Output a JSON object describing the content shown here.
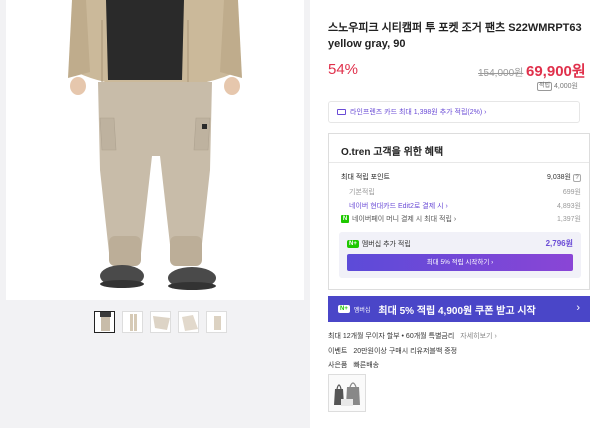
{
  "product": {
    "title": "스노우피크 시티캠퍼 투 포켓 조거 팬츠 S22WMRPT63 yellow gray, 90",
    "discount": "54%",
    "original_price": "154,000원",
    "price": "69,900원",
    "point_badge": "적립",
    "point": "4,000원"
  },
  "card_banner": {
    "text": "라인프렌즈 카드 최대 1,398원 추가 적립(2%) ›"
  },
  "benefit": {
    "title": "O.tren 고객을 위한 혜택",
    "max_point_label": "최대 적립 포인트",
    "max_point_value": "9,038원",
    "help": "?",
    "base_label": "기본적립",
    "base_value": "699원",
    "card_label": "네이버 현대카드 Edit2로 결제 시 ›",
    "card_value": "4,893원",
    "npay_label": "네이버페이 머니 결제 시 최대 적립 ›",
    "npay_value": "1,397원",
    "npay_icon": "N",
    "member_badge": "N+",
    "member_label": "멤버십 추가 적립",
    "member_value": "2,796원",
    "member_button": "최대 5% 적립 시작하기 ›"
  },
  "coupon": {
    "badge": "N+",
    "badge_label": "멤버십",
    "text": "최대 5% 적립 4,900원 쿠폰 받고 시작",
    "arrow": "›"
  },
  "info": {
    "installment_text": "최대 12개월 무이자 할부 • 60개월 특별금리",
    "installment_more": "자세히보기 ›",
    "event_label": "이벤트",
    "event_text": "20만원이상 구매시 리유저블백 증정",
    "gift_label": "사은품",
    "gift_text": "빠른배송"
  },
  "colors": {
    "accent": "#e0304b",
    "purple": "#6a4bd6",
    "coupon_bg": "#4a46c8",
    "naver_green": "#1ec800"
  }
}
